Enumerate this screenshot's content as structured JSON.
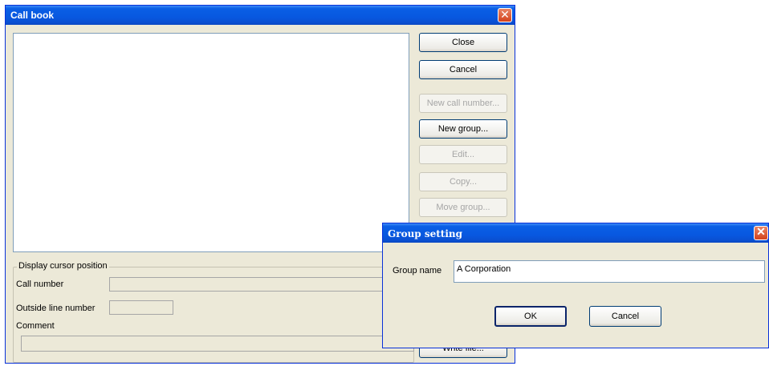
{
  "main_window": {
    "title": "Call book",
    "close_glyph": "✕",
    "buttons": {
      "close": "Close",
      "cancel": "Cancel",
      "new_call_number": "New call number...",
      "new_group": "New group...",
      "edit": "Edit...",
      "copy": "Copy...",
      "move_group": "Move group...",
      "write_file": "Write file..."
    },
    "cursor_group": {
      "legend": "Display cursor position",
      "call_number_label": "Call number",
      "outside_line_label": "Outside line number",
      "comment_label": "Comment"
    }
  },
  "dialog": {
    "title": "Group setting",
    "close_glyph": "✕",
    "group_name_label": "Group name",
    "group_name_value": "A Corporation",
    "ok_label": "OK",
    "cancel_label": "Cancel"
  },
  "colors": {
    "titlebar": "#0a5fe5",
    "window_bg": "#ece9d8",
    "close_button": "#d4421c",
    "disabled_text": "#a6a6a6"
  }
}
